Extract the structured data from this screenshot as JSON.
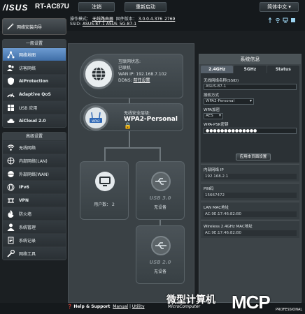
{
  "header": {
    "logo": "/ISUS",
    "model": "RT-AC87U",
    "logout": "注销",
    "reboot": "重新启动",
    "language": "简体中文",
    "op_mode_label": "操作模式：",
    "op_mode_value": "无线路由器",
    "firmware_label": "固件版本：",
    "firmware_value": "3.0.0.4.376_2769",
    "ssid_label": "SSID:",
    "ssid_values": "ASUS-87-1  ASUS_5G-87-1"
  },
  "status_icons": [
    "usb-icon",
    "wireless-icon",
    "network-icon",
    "app-icon"
  ],
  "sidebar": {
    "qis_label": "网络安装向导",
    "general_title": "一般设置",
    "general_items": [
      {
        "label": "网络地图",
        "icon": "network-map-icon",
        "active": true
      },
      {
        "label": "访客网络",
        "icon": "guest-network-icon"
      },
      {
        "label": "AiProtection",
        "icon": "shield-icon"
      },
      {
        "label": "Adaptive QoS",
        "icon": "qos-icon"
      },
      {
        "label": "USB 应用",
        "icon": "usb-app-icon"
      },
      {
        "label": "AiCloud 2.0",
        "icon": "cloud-icon"
      }
    ],
    "advanced_title": "高级设置",
    "advanced_items": [
      {
        "label": "无线网络",
        "icon": "wireless-icon"
      },
      {
        "label": "内部网络(LAN)",
        "icon": "lan-icon"
      },
      {
        "label": "外部网络(WAN)",
        "icon": "wan-icon"
      },
      {
        "label": "IPv6",
        "icon": "ipv6-icon"
      },
      {
        "label": "VPN",
        "icon": "vpn-icon"
      },
      {
        "label": "防火墙",
        "icon": "firewall-icon"
      },
      {
        "label": "系统管理",
        "icon": "admin-icon"
      },
      {
        "label": "系统记录",
        "icon": "log-icon"
      },
      {
        "label": "网络工具",
        "icon": "tools-icon"
      }
    ]
  },
  "map": {
    "internet_status_label": "互联网状态:",
    "internet_status": "已联机",
    "wan_ip": "WAN IP: 192.168.7.102",
    "ddns_label": "DDNS:",
    "ddns_link": "前往设置",
    "security_label": "无线安全层级:",
    "security_value": "WPA2-Personal",
    "clients_label": "用户数：",
    "clients_count": "2",
    "usb1_label": "USB 3.0",
    "usb1_status": "无设备",
    "usb2_label": "USB 2.0",
    "usb2_status": "无设备"
  },
  "panel": {
    "title": "系统信息",
    "tabs": [
      "2.4GHz",
      "5GHz",
      "Status"
    ],
    "ssid_label": "无线网络名称(SSID)",
    "ssid_value": "ASUS-87-1",
    "auth_label": "授权方式",
    "auth_value": "WPA2-Personal",
    "wpa_enc_label": "WPA加密",
    "wpa_enc_value": "AES",
    "psk_label": "WPA-PSK密钥",
    "psk_value": "●●●●●●●●●●●●●●",
    "apply": "应用本页面设置",
    "lan_ip_label": "内部网络 IP",
    "lan_ip_value": "192.168.2.1",
    "pin_label": "PIN码",
    "pin_value": "15667472",
    "lan_mac_label": "LAN MAC地址",
    "lan_mac_value": "AC:9E:17:46:82:B0",
    "wl_mac_label": "Wireless 2.4GHz MAC地址",
    "wl_mac_value": "AC:9E:17:46:82:B0"
  },
  "footer": {
    "help": "Help & Support",
    "manual": "Manual",
    "utility": "Utility",
    "sep": "|"
  },
  "watermark": {
    "cn": "微型计算机",
    "en": "MicroComputer",
    "brand": "MCP",
    "sub": "PROFESSIONAL"
  }
}
